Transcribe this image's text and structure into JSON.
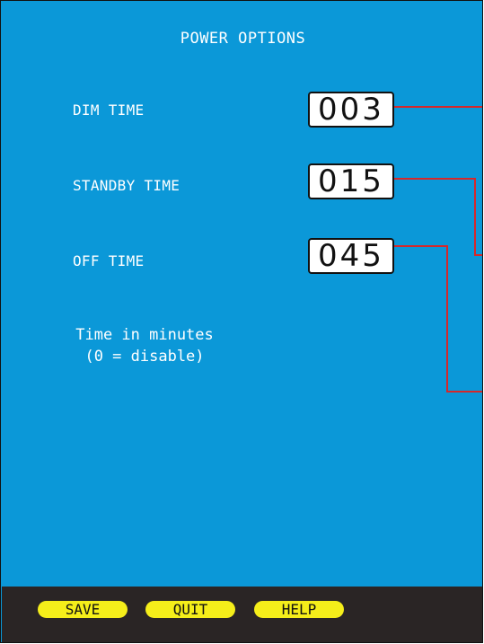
{
  "screen": {
    "title": "POWER OPTIONS",
    "background_color": "#0b98d8",
    "leader_line_color": "#d6282b"
  },
  "settings": [
    {
      "label": "DIM TIME",
      "value": "003"
    },
    {
      "label": "STANDBY TIME",
      "value": "015"
    },
    {
      "label": "OFF TIME",
      "value": "045"
    }
  ],
  "hint": {
    "line1": "Time in minutes",
    "line2": "(0 = disable)"
  },
  "footer": {
    "background_color": "#2a2525",
    "button_color": "#f5ee1a",
    "save_label": "SAVE",
    "quit_label": "QUIT",
    "help_label": "HELP"
  }
}
